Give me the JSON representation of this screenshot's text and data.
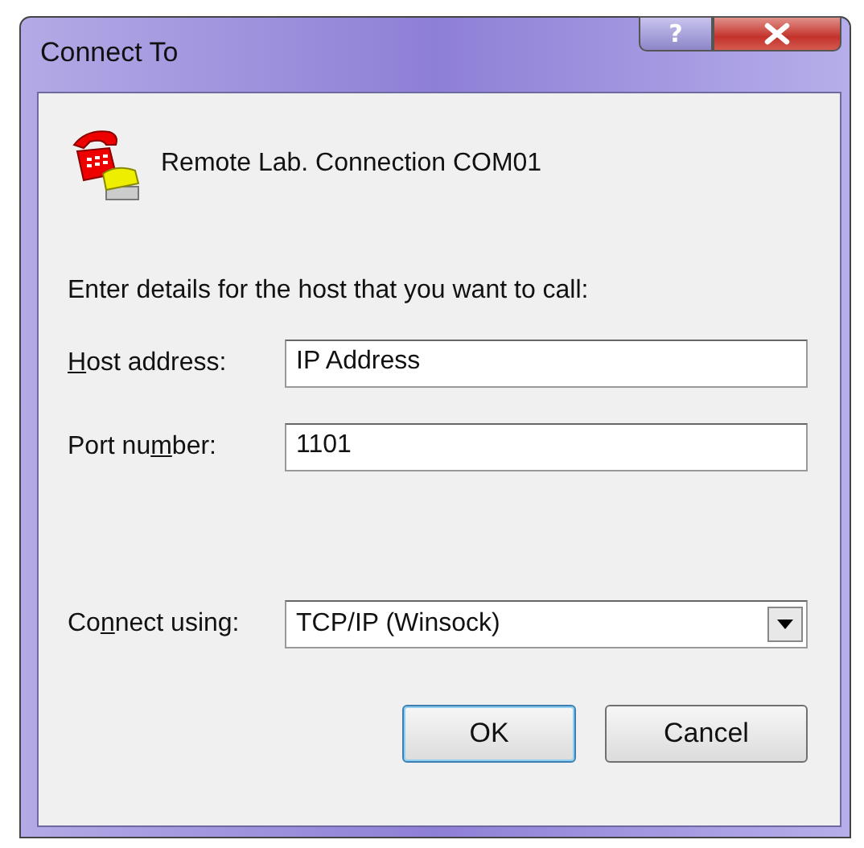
{
  "window": {
    "title": "Connect To",
    "help_button": "?"
  },
  "connection_name": "Remote Lab. Connection COM01",
  "instruction": "Enter details for the host that you want to call:",
  "fields": [
    {
      "kind": "text",
      "label": {
        "key": "H",
        "after": "ost address:"
      },
      "value": "IP Address"
    },
    {
      "kind": "text",
      "label": {
        "before": "Port nu",
        "key": "m",
        "after": "ber:"
      },
      "value": "1101"
    },
    {
      "kind": "dropdown",
      "label": {
        "before": "Co",
        "key": "n",
        "after": "nect using:"
      },
      "value": "TCP/IP (Winsock)"
    }
  ],
  "buttons": [
    "OK",
    "Cancel"
  ]
}
